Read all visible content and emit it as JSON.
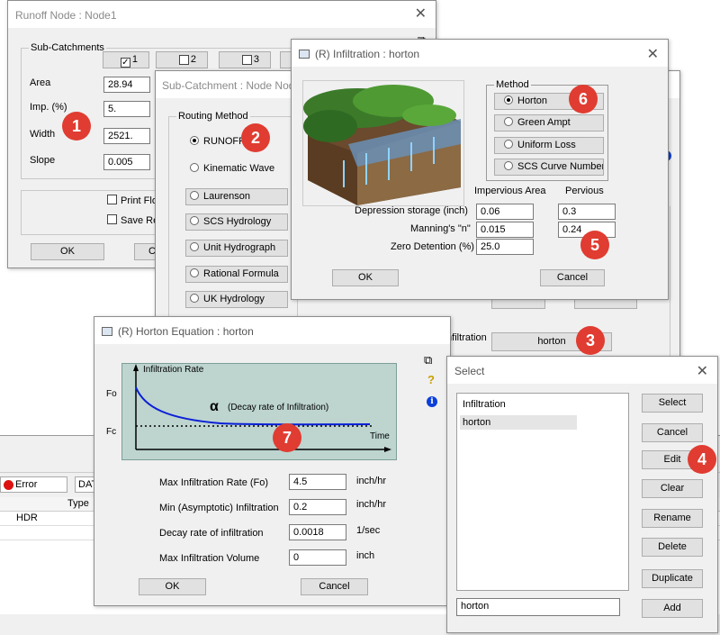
{
  "runoff": {
    "title": "Runoff Node : Node1",
    "subcatchments_label": "Sub-Catchments",
    "tabs": [
      "1",
      "2",
      "3"
    ],
    "fields": [
      {
        "label": "Area",
        "value": "28.94"
      },
      {
        "label": "Imp. (%)",
        "value": "5."
      },
      {
        "label": "Width",
        "value": "2521."
      },
      {
        "label": "Slope",
        "value": "0.005"
      }
    ],
    "print_flow": "Print Flow",
    "save_res": "Save Res",
    "ok": "OK",
    "cancel_fragment": "C"
  },
  "subcatch": {
    "title": "Sub-Catchment : Node Node",
    "routing_label": "Routing Method",
    "runoff": "RUNOFF",
    "kinematic": "Kinematic Wave",
    "methods": [
      "Laurenson",
      "SCS Hydrology",
      "Unit Hydrograph",
      "Rational Formula",
      "UK Hydrology"
    ],
    "infiltration_label": "Infiltration",
    "infiltration_value": "horton"
  },
  "infil": {
    "title": "(R) Infiltration : horton",
    "method_label": "Method",
    "methods": [
      "Horton",
      "Green Ampt",
      "Uniform Loss",
      "SCS Curve Number"
    ],
    "col_impervious": "Impervious Area",
    "col_pervious": "Pervious",
    "rows": [
      {
        "label": "Depression storage   (inch)",
        "imp": "0.06",
        "perv": "0.3"
      },
      {
        "label": "Manning's \"n\"",
        "imp": "0.015",
        "perv": "0.24"
      },
      {
        "label": "Zero Detention (%)",
        "imp": "25.0",
        "perv": ""
      }
    ],
    "ok": "OK",
    "cancel": "Cancel"
  },
  "horton": {
    "title": "(R) Horton Equation : horton",
    "graph": {
      "y_label": "Infiltration Rate",
      "fo": "Fo",
      "fc": "Fc",
      "x_label": "Time",
      "alpha": "α",
      "decay_note": "(Decay rate of Infiltration)"
    },
    "params": [
      {
        "label": "Max Infiltration Rate (Fo)",
        "value": "4.5",
        "unit": "inch/hr"
      },
      {
        "label": "Min (Asymptotic) Infiltration",
        "value": "0.2",
        "unit": "inch/hr"
      },
      {
        "label": "Decay rate of infiltration",
        "value": "0.0018",
        "unit": "1/sec"
      },
      {
        "label": "Max Infiltration Volume",
        "value": "0",
        "unit": "inch"
      }
    ],
    "ok": "OK",
    "cancel": "Cancel"
  },
  "select": {
    "title": "Select",
    "list": [
      "Infiltration",
      "horton"
    ],
    "buttons": [
      "Select",
      "Cancel",
      "Edit",
      "Clear",
      "Rename",
      "Delete",
      "Duplicate",
      "Add"
    ],
    "input_value": "horton"
  },
  "bottom": {
    "error_label": "Error",
    "dat_fragment": "DAT",
    "type_header": "Type",
    "row_value": "HDR"
  },
  "badges": [
    "1",
    "2",
    "3",
    "4",
    "5",
    "6",
    "7"
  ],
  "colors": {
    "badge": "#e03c31",
    "curve": "#0b1fd6",
    "graph_bg": "#bdd4cf",
    "selection": "#e5e5e5"
  }
}
